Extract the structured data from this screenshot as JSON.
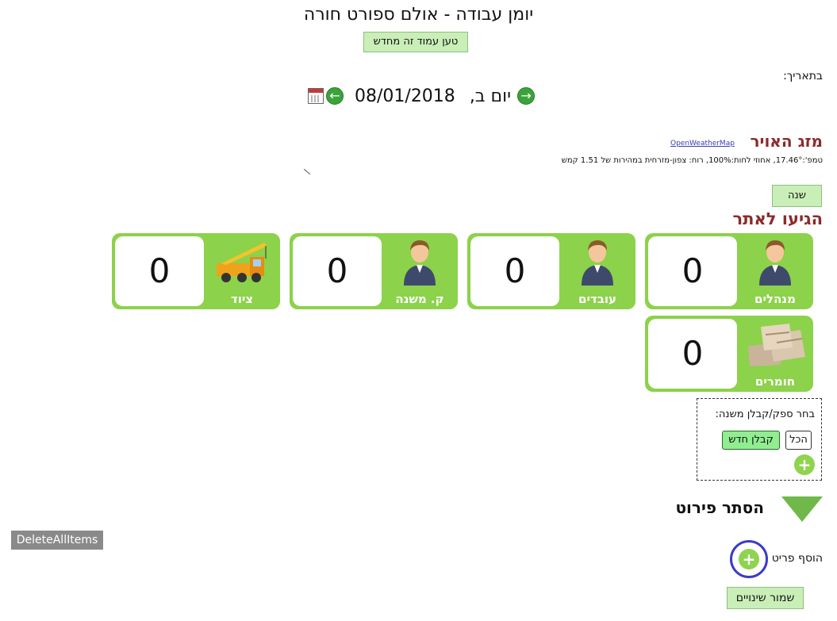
{
  "page": {
    "title": "יומן עבודה - אולם ספורט חורה",
    "reload_label": "טען עמוד זה מחדש"
  },
  "date_nav": {
    "label": "בתאריך:",
    "day": "יום ב,",
    "date": "08/01/2018"
  },
  "weather": {
    "title": "מזג האויר",
    "provider_link": "OpenWeatherMap",
    "details": "טמפ':17.46°, אחוזי לחות:100%, רוח: צפון-מזרחית במהירות של 1.51 קמש"
  },
  "change_button": "שנה",
  "arrived": {
    "title": "הגיעו לאתר",
    "cards": [
      {
        "label": "מנהלים",
        "count": "0",
        "icon": "person-icon"
      },
      {
        "label": "עובדים",
        "count": "0",
        "icon": "person-icon"
      },
      {
        "label": "ק. משנה",
        "count": "0",
        "icon": "person-icon"
      },
      {
        "label": "ציוד",
        "count": "0",
        "icon": "crane-truck-icon"
      },
      {
        "label": "חומרים",
        "count": "0",
        "icon": "cement-bags-icon"
      }
    ]
  },
  "supplier": {
    "label": "בחר ספק/קבלן משנה:",
    "all_button": "הכל",
    "new_button": "קבלן חדש"
  },
  "details": {
    "hide_label": "הסתר פירוט",
    "add_item_label": "הוסף פריט",
    "delete_all": "DeleteAllItems",
    "save_label": "שמור שינויים"
  }
}
